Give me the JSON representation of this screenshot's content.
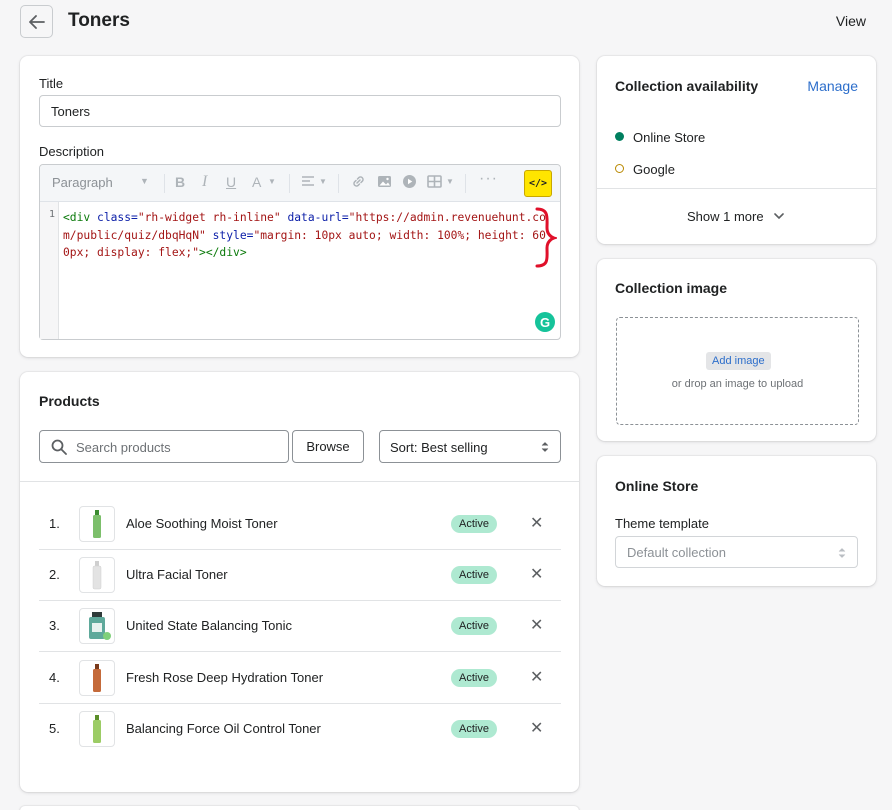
{
  "header": {
    "title": "Toners",
    "view_label": "View"
  },
  "details": {
    "title_label": "Title",
    "title_value": "Toners",
    "description_label": "Description",
    "toolbar": {
      "paragraph_select": "Paragraph"
    },
    "line_number": "1",
    "code": {
      "p1": "<div",
      "p2": " class=",
      "p3": "\"rh-widget rh-inline\"",
      "p4": " data-url=",
      "p5": "\"https://admin.revenuehunt.com/public/quiz/dbqHqN\"",
      "p6": " style=",
      "p7": "\"margin: 10px auto; width: 100%; height: 600px; display: flex;\"",
      "p8": "></div>"
    },
    "grammarly_letter": "G"
  },
  "products": {
    "title": "Products",
    "search_placeholder": "Search products",
    "browse_label": "Browse",
    "sort_label": "Sort: Best selling",
    "items": [
      {
        "num": "1.",
        "name": "Aloe Soothing Moist Toner",
        "status": "Active",
        "color": "#7cbf6b"
      },
      {
        "num": "2.",
        "name": "Ultra Facial Toner",
        "status": "Active",
        "color": "#e3e3e3"
      },
      {
        "num": "3.",
        "name": "United State Balancing Tonic",
        "status": "Active",
        "color": "#5fa99b"
      },
      {
        "num": "4.",
        "name": "Fresh Rose Deep Hydration Toner",
        "status": "Active",
        "color": "#c46a3a"
      },
      {
        "num": "5.",
        "name": "Balancing Force Oil Control Toner",
        "status": "Active",
        "color": "#9ccc65"
      }
    ]
  },
  "availability": {
    "title": "Collection availability",
    "manage_label": "Manage",
    "channels": [
      {
        "name": "Online Store",
        "status_color": "#007f5f"
      },
      {
        "name": "Google",
        "status_color": "#b98900"
      }
    ],
    "show_more_label": "Show 1 more"
  },
  "image_card": {
    "title": "Collection image",
    "add_label": "Add image",
    "drop_hint": "or drop an image to upload"
  },
  "online_store": {
    "title": "Online Store",
    "template_label": "Theme template",
    "template_value": "Default collection"
  },
  "colors": {
    "active_badge": "#aee9d1",
    "link": "#2c6ecb",
    "highlight_code_button": "#ffe500",
    "annotation_red": "#e0102a"
  }
}
